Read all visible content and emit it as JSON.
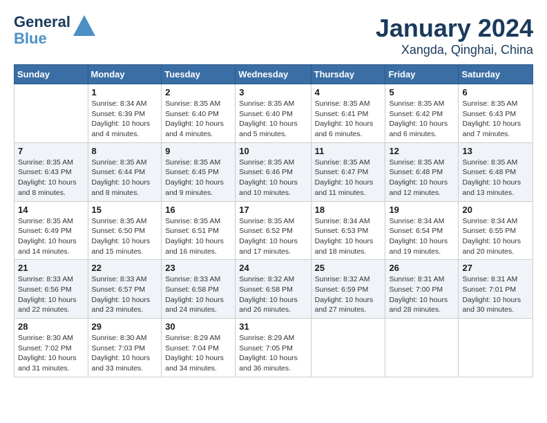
{
  "header": {
    "logo_line1": "General",
    "logo_line2": "Blue",
    "month_title": "January 2024",
    "location": "Xangda, Qinghai, China"
  },
  "days_of_week": [
    "Sunday",
    "Monday",
    "Tuesday",
    "Wednesday",
    "Thursday",
    "Friday",
    "Saturday"
  ],
  "weeks": [
    [
      {
        "num": "",
        "sunrise": "",
        "sunset": "",
        "daylight": ""
      },
      {
        "num": "1",
        "sunrise": "Sunrise: 8:34 AM",
        "sunset": "Sunset: 6:39 PM",
        "daylight": "Daylight: 10 hours and 4 minutes."
      },
      {
        "num": "2",
        "sunrise": "Sunrise: 8:35 AM",
        "sunset": "Sunset: 6:40 PM",
        "daylight": "Daylight: 10 hours and 4 minutes."
      },
      {
        "num": "3",
        "sunrise": "Sunrise: 8:35 AM",
        "sunset": "Sunset: 6:40 PM",
        "daylight": "Daylight: 10 hours and 5 minutes."
      },
      {
        "num": "4",
        "sunrise": "Sunrise: 8:35 AM",
        "sunset": "Sunset: 6:41 PM",
        "daylight": "Daylight: 10 hours and 6 minutes."
      },
      {
        "num": "5",
        "sunrise": "Sunrise: 8:35 AM",
        "sunset": "Sunset: 6:42 PM",
        "daylight": "Daylight: 10 hours and 6 minutes."
      },
      {
        "num": "6",
        "sunrise": "Sunrise: 8:35 AM",
        "sunset": "Sunset: 6:43 PM",
        "daylight": "Daylight: 10 hours and 7 minutes."
      }
    ],
    [
      {
        "num": "7",
        "sunrise": "Sunrise: 8:35 AM",
        "sunset": "Sunset: 6:43 PM",
        "daylight": "Daylight: 10 hours and 8 minutes."
      },
      {
        "num": "8",
        "sunrise": "Sunrise: 8:35 AM",
        "sunset": "Sunset: 6:44 PM",
        "daylight": "Daylight: 10 hours and 8 minutes."
      },
      {
        "num": "9",
        "sunrise": "Sunrise: 8:35 AM",
        "sunset": "Sunset: 6:45 PM",
        "daylight": "Daylight: 10 hours and 9 minutes."
      },
      {
        "num": "10",
        "sunrise": "Sunrise: 8:35 AM",
        "sunset": "Sunset: 6:46 PM",
        "daylight": "Daylight: 10 hours and 10 minutes."
      },
      {
        "num": "11",
        "sunrise": "Sunrise: 8:35 AM",
        "sunset": "Sunset: 6:47 PM",
        "daylight": "Daylight: 10 hours and 11 minutes."
      },
      {
        "num": "12",
        "sunrise": "Sunrise: 8:35 AM",
        "sunset": "Sunset: 6:48 PM",
        "daylight": "Daylight: 10 hours and 12 minutes."
      },
      {
        "num": "13",
        "sunrise": "Sunrise: 8:35 AM",
        "sunset": "Sunset: 6:48 PM",
        "daylight": "Daylight: 10 hours and 13 minutes."
      }
    ],
    [
      {
        "num": "14",
        "sunrise": "Sunrise: 8:35 AM",
        "sunset": "Sunset: 6:49 PM",
        "daylight": "Daylight: 10 hours and 14 minutes."
      },
      {
        "num": "15",
        "sunrise": "Sunrise: 8:35 AM",
        "sunset": "Sunset: 6:50 PM",
        "daylight": "Daylight: 10 hours and 15 minutes."
      },
      {
        "num": "16",
        "sunrise": "Sunrise: 8:35 AM",
        "sunset": "Sunset: 6:51 PM",
        "daylight": "Daylight: 10 hours and 16 minutes."
      },
      {
        "num": "17",
        "sunrise": "Sunrise: 8:35 AM",
        "sunset": "Sunset: 6:52 PM",
        "daylight": "Daylight: 10 hours and 17 minutes."
      },
      {
        "num": "18",
        "sunrise": "Sunrise: 8:34 AM",
        "sunset": "Sunset: 6:53 PM",
        "daylight": "Daylight: 10 hours and 18 minutes."
      },
      {
        "num": "19",
        "sunrise": "Sunrise: 8:34 AM",
        "sunset": "Sunset: 6:54 PM",
        "daylight": "Daylight: 10 hours and 19 minutes."
      },
      {
        "num": "20",
        "sunrise": "Sunrise: 8:34 AM",
        "sunset": "Sunset: 6:55 PM",
        "daylight": "Daylight: 10 hours and 20 minutes."
      }
    ],
    [
      {
        "num": "21",
        "sunrise": "Sunrise: 8:33 AM",
        "sunset": "Sunset: 6:56 PM",
        "daylight": "Daylight: 10 hours and 22 minutes."
      },
      {
        "num": "22",
        "sunrise": "Sunrise: 8:33 AM",
        "sunset": "Sunset: 6:57 PM",
        "daylight": "Daylight: 10 hours and 23 minutes."
      },
      {
        "num": "23",
        "sunrise": "Sunrise: 8:33 AM",
        "sunset": "Sunset: 6:58 PM",
        "daylight": "Daylight: 10 hours and 24 minutes."
      },
      {
        "num": "24",
        "sunrise": "Sunrise: 8:32 AM",
        "sunset": "Sunset: 6:58 PM",
        "daylight": "Daylight: 10 hours and 26 minutes."
      },
      {
        "num": "25",
        "sunrise": "Sunrise: 8:32 AM",
        "sunset": "Sunset: 6:59 PM",
        "daylight": "Daylight: 10 hours and 27 minutes."
      },
      {
        "num": "26",
        "sunrise": "Sunrise: 8:31 AM",
        "sunset": "Sunset: 7:00 PM",
        "daylight": "Daylight: 10 hours and 28 minutes."
      },
      {
        "num": "27",
        "sunrise": "Sunrise: 8:31 AM",
        "sunset": "Sunset: 7:01 PM",
        "daylight": "Daylight: 10 hours and 30 minutes."
      }
    ],
    [
      {
        "num": "28",
        "sunrise": "Sunrise: 8:30 AM",
        "sunset": "Sunset: 7:02 PM",
        "daylight": "Daylight: 10 hours and 31 minutes."
      },
      {
        "num": "29",
        "sunrise": "Sunrise: 8:30 AM",
        "sunset": "Sunset: 7:03 PM",
        "daylight": "Daylight: 10 hours and 33 minutes."
      },
      {
        "num": "30",
        "sunrise": "Sunrise: 8:29 AM",
        "sunset": "Sunset: 7:04 PM",
        "daylight": "Daylight: 10 hours and 34 minutes."
      },
      {
        "num": "31",
        "sunrise": "Sunrise: 8:29 AM",
        "sunset": "Sunset: 7:05 PM",
        "daylight": "Daylight: 10 hours and 36 minutes."
      },
      {
        "num": "",
        "sunrise": "",
        "sunset": "",
        "daylight": ""
      },
      {
        "num": "",
        "sunrise": "",
        "sunset": "",
        "daylight": ""
      },
      {
        "num": "",
        "sunrise": "",
        "sunset": "",
        "daylight": ""
      }
    ]
  ]
}
